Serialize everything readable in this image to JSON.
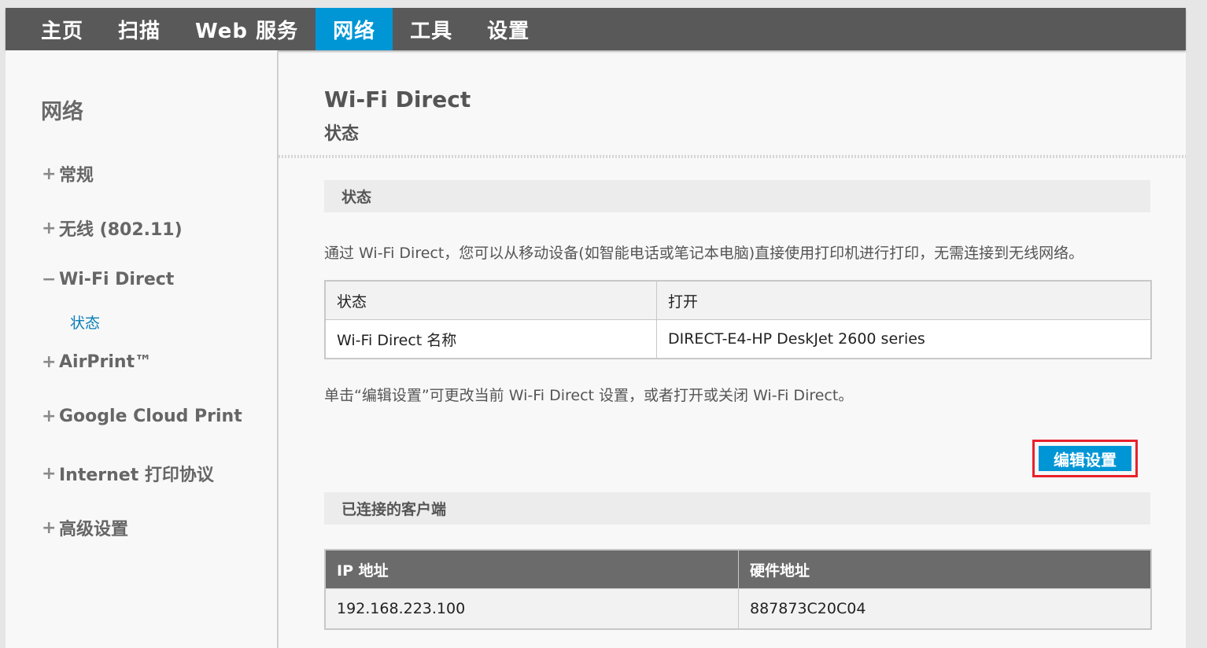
{
  "topnav": {
    "tabs": [
      {
        "label": "主页"
      },
      {
        "label": "扫描"
      },
      {
        "label": "Web 服务"
      },
      {
        "label": "网络"
      },
      {
        "label": "工具"
      },
      {
        "label": "设置"
      }
    ],
    "active_tab": "网络",
    "active_color": "#0096d6"
  },
  "sidebar": {
    "title": "网络",
    "items": [
      {
        "symbol": "+",
        "label": "常规"
      },
      {
        "symbol": "+",
        "label": "无线 (802.11)"
      },
      {
        "symbol": "−",
        "label": "Wi-Fi Direct"
      },
      {
        "symbol": "+",
        "label": "AirPrint™"
      },
      {
        "symbol": "+",
        "label": "Google Cloud Print"
      },
      {
        "symbol": "+",
        "label": "Internet 打印协议"
      },
      {
        "symbol": "+",
        "label": "高级设置"
      }
    ],
    "sub_item": "状态"
  },
  "main": {
    "title": "Wi-Fi Direct",
    "subtitle": "状态",
    "status_section": {
      "heading": "状态",
      "description": "通过 Wi-Fi Direct，您可以从移动设备(如智能电话或笔记本电脑)直接使用打印机进行打印，无需连接到无线网络。",
      "rows": [
        {
          "label": "状态",
          "value": "打开"
        },
        {
          "label": "Wi-Fi Direct 名称",
          "value": "DIRECT-E4-HP DeskJet 2600 series"
        }
      ],
      "hint": "单击“编辑设置”可更改当前 Wi-Fi Direct 设置，或者打开或关闭 Wi-Fi Direct。",
      "edit_button": "编辑设置"
    },
    "clients_section": {
      "heading": "已连接的客户端",
      "columns": [
        "IP 地址",
        "硬件地址"
      ],
      "rows": [
        [
          "192.168.223.100",
          "887873C20C04"
        ]
      ]
    }
  }
}
